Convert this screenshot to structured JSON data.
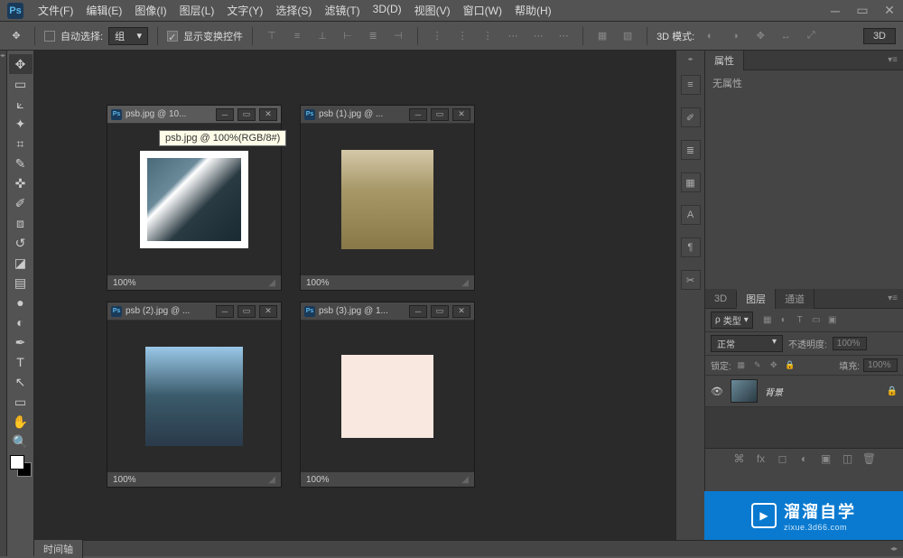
{
  "app": {
    "logo": "Ps"
  },
  "menu": [
    "文件(F)",
    "编辑(E)",
    "图像(I)",
    "图层(L)",
    "文字(Y)",
    "选择(S)",
    "滤镜(T)",
    "3D(D)",
    "视图(V)",
    "窗口(W)",
    "帮助(H)"
  ],
  "options": {
    "auto_select": "自动选择:",
    "group": "组",
    "show_transform": "显示变换控件",
    "mode_3d_label": "3D 模式:",
    "btn_3d": "3D"
  },
  "docs": [
    {
      "title": "psb.jpg @ 10...",
      "zoom": "100%",
      "tooltip": "psb.jpg @ 100%(RGB/8#)",
      "active": true
    },
    {
      "title": "psb (1).jpg @ ...",
      "zoom": "100%",
      "active": false
    },
    {
      "title": "psb (2).jpg @ ...",
      "zoom": "100%",
      "active": false
    },
    {
      "title": "psb (3).jpg @ 1...",
      "zoom": "100%",
      "active": false
    }
  ],
  "timeline": {
    "label": "时间轴"
  },
  "panels": {
    "properties": {
      "tab": "属性",
      "content": "无属性"
    },
    "layers": {
      "tabs": [
        "3D",
        "图层",
        "通道"
      ],
      "type_filter": "类型",
      "blend_mode": "正常",
      "opacity_label": "不透明度:",
      "opacity_value": "100%",
      "lock_label": "锁定:",
      "fill_label": "填充:",
      "fill_value": "100%",
      "layers": [
        {
          "name": "背景"
        }
      ]
    }
  },
  "watermark": {
    "main": "溜溜自学",
    "sub": "zixue.3d66.com"
  }
}
